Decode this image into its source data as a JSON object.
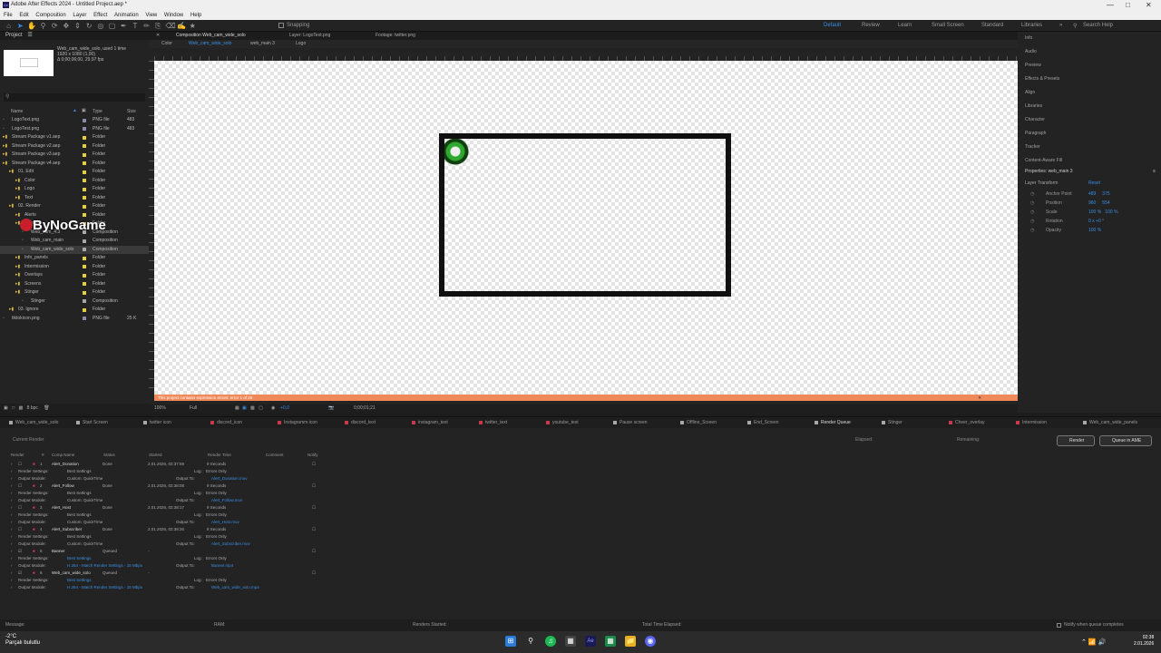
{
  "window": {
    "title": "Adobe After Effects 2024 - Untitled Project.aep *"
  },
  "menu": [
    "File",
    "Edit",
    "Composition",
    "Layer",
    "Effect",
    "Animation",
    "View",
    "Window",
    "Help"
  ],
  "toolbar": {
    "snapping": "Snapping",
    "workspaces": [
      "Default",
      "Review",
      "Learn",
      "Small Screen",
      "Standard",
      "Libraries"
    ],
    "search_help": "Search Help"
  },
  "project": {
    "tab": "Project",
    "selected_name": "Web_cam_wide_solo",
    "selected_used": ", used 1 time",
    "selected_info1": "1920 x 1080 (1,00)",
    "selected_info2": "Δ 0;00;06;00, 29,97 fps",
    "columns": {
      "name": "Name",
      "type": "Type",
      "size": "Size"
    },
    "items": [
      {
        "name": "LogoText.png",
        "type": "PNG file",
        "size": "483",
        "indent": 0,
        "color": "#8a8aa8"
      },
      {
        "name": "LogoTest.png",
        "type": "PNG file",
        "size": "483",
        "indent": 0,
        "color": "#8a8aa8"
      },
      {
        "name": "Stream Package v1.aep",
        "type": "Folder",
        "size": "",
        "indent": 0,
        "color": "#e6cf3a"
      },
      {
        "name": "Stream Package v2.aep",
        "type": "Folder",
        "size": "",
        "indent": 0,
        "color": "#e6cf3a"
      },
      {
        "name": "Stream Package v3.aep",
        "type": "Folder",
        "size": "",
        "indent": 0,
        "color": "#e6cf3a"
      },
      {
        "name": "Stream Package v4.aep",
        "type": "Folder",
        "size": "",
        "indent": 0,
        "color": "#e6cf3a"
      },
      {
        "name": "01. Edit",
        "type": "Folder",
        "size": "",
        "indent": 1,
        "color": "#e6cf3a"
      },
      {
        "name": "Color",
        "type": "Folder",
        "size": "",
        "indent": 2,
        "color": "#e6cf3a"
      },
      {
        "name": "Logo",
        "type": "Folder",
        "size": "",
        "indent": 2,
        "color": "#e6cf3a"
      },
      {
        "name": "Text",
        "type": "Folder",
        "size": "",
        "indent": 2,
        "color": "#e6cf3a"
      },
      {
        "name": "02. Render",
        "type": "Folder",
        "size": "",
        "indent": 1,
        "color": "#e6cf3a"
      },
      {
        "name": "Alerts",
        "type": "Folder",
        "size": "",
        "indent": 2,
        "color": "#e6cf3a"
      },
      {
        "name": "Banner",
        "type": "Folder",
        "size": "",
        "indent": 2,
        "color": "#e6cf3a"
      },
      {
        "name": "Web_cam_4:3",
        "type": "Composition",
        "size": "",
        "indent": 3,
        "color": "#a8a8a8"
      },
      {
        "name": "Web_cam_main",
        "type": "Composition",
        "size": "",
        "indent": 3,
        "color": "#a8a8a8"
      },
      {
        "name": "Web_cam_wide_solo",
        "type": "Composition",
        "size": "",
        "indent": 3,
        "color": "#a8a8a8",
        "selected": true
      },
      {
        "name": "Info_panels",
        "type": "Folder",
        "size": "",
        "indent": 2,
        "color": "#e6cf3a"
      },
      {
        "name": "Intermission",
        "type": "Folder",
        "size": "",
        "indent": 2,
        "color": "#e6cf3a"
      },
      {
        "name": "Overlays",
        "type": "Folder",
        "size": "",
        "indent": 2,
        "color": "#e6cf3a"
      },
      {
        "name": "Screens",
        "type": "Folder",
        "size": "",
        "indent": 2,
        "color": "#e6cf3a"
      },
      {
        "name": "Stinger",
        "type": "Folder",
        "size": "",
        "indent": 2,
        "color": "#e6cf3a"
      },
      {
        "name": "Stinger",
        "type": "Composition",
        "size": "",
        "indent": 3,
        "color": "#a8a8a8"
      },
      {
        "name": "03. Ignore",
        "type": "Folder",
        "size": "",
        "indent": 1,
        "color": "#e6cf3a"
      },
      {
        "name": "tiktokicon.png",
        "type": "PNG file",
        "size": "25 K",
        "indent": 0,
        "color": "#8a8aa8"
      }
    ],
    "watermark": "ByNoGame",
    "bpc": "8 bpc"
  },
  "comp": {
    "tabs": [
      "Composition Web_cam_wide_solo",
      "Layer: LogoText.png",
      "Footage: twitter.png"
    ],
    "subtabs": [
      "Color",
      "Web_cam_wide_solo",
      "web_main 3",
      "Logo"
    ],
    "warning": "This project contains expression errors: error 1 of 26",
    "zoom": "100%",
    "resolution": "Full",
    "timecode": "0;00;01;21",
    "exposure": "+0,0"
  },
  "right": {
    "panels": [
      "Info",
      "Audio",
      "Preview",
      "Effects & Presets",
      "Align",
      "Libraries",
      "Character",
      "Paragraph",
      "Tracker",
      "Content-Aware Fill"
    ],
    "properties_title": "Properties: web_main 3",
    "layer_transform": "Layer Transform",
    "reset": "Reset",
    "props": [
      {
        "label": "Anchor Point",
        "value": "489     375"
      },
      {
        "label": "Position",
        "value": "960     554"
      },
      {
        "label": "Scale",
        "value": "100 %   100 %"
      },
      {
        "label": "Rotation",
        "value": "0 x +0 °"
      },
      {
        "label": "Opacity",
        "value": "100 %"
      }
    ]
  },
  "timeline_tabs": [
    "Web_cam_wide_solo",
    "Start Screen",
    "twitter icon",
    "discord_icon",
    "Instagramm icon",
    "discord_text",
    "instagram_text",
    "twitter_text",
    "youtube_text",
    "Pause screen",
    "Offline_Screen",
    "End_Screen",
    "Render Queue",
    "Stinger",
    "Cheer_overlay",
    "Intermission",
    "Web_cam_wide_panels"
  ],
  "timeline_tab_colors": [
    "#a8a8a8",
    "#a8a8a8",
    "#a8a8a8",
    "#c83a4a",
    "#c83a4a",
    "#c83a4a",
    "#c83a4a",
    "#c83a4a",
    "#c83a4a",
    "#a8a8a8",
    "#a8a8a8",
    "#a8a8a8",
    "#a8a8a8",
    "#a8a8a8",
    "#c83a4a",
    "#c83a4a",
    "#a8a8a8"
  ],
  "render_queue": {
    "current_render": "Current Render",
    "elapsed_label": "Elapsed:",
    "remaining_label": "Remaining:",
    "render_button": "Render",
    "queue_ame": "Queue in AME",
    "columns": [
      "Render",
      "#",
      "Comp Name",
      "Status",
      "Started",
      "Render Time",
      "Comment",
      "Notify"
    ],
    "items": [
      {
        "num": "1",
        "name": "Alert_Donation",
        "status": "Done",
        "started": "2.01.2026, 02:37:59",
        "time": "9 Seconds",
        "rs": "Best Settings",
        "log": "Errors Only",
        "om": "Custom: QuickTime",
        "out": "Alert_Donation.mov",
        "checked": false,
        "blue": false
      },
      {
        "num": "2",
        "name": "Alert_Follow",
        "status": "Done",
        "started": "2.01.2026, 02:38:08",
        "time": "9 Seconds",
        "rs": "Best Settings",
        "log": "Errors Only",
        "om": "Custom: QuickTime",
        "out": "Alert_Follow.mov",
        "checked": false,
        "blue": false
      },
      {
        "num": "3",
        "name": "Alert_Host",
        "status": "Done",
        "started": "2.01.2026, 02:38:17",
        "time": "9 Seconds",
        "rs": "Best Settings",
        "log": "Errors Only",
        "om": "Custom: QuickTime",
        "out": "Alert_Host.mov",
        "checked": false,
        "blue": false
      },
      {
        "num": "4",
        "name": "Alert_Subscriber",
        "status": "Done",
        "started": "2.01.2026, 02:38:26",
        "time": "8 Seconds",
        "rs": "Best Settings",
        "log": "Errors Only",
        "om": "Custom: QuickTime",
        "out": "Alert_Subscriber.mov",
        "checked": false,
        "blue": false
      },
      {
        "num": "5",
        "name": "Banner",
        "status": "Queued",
        "started": "-",
        "time": "",
        "rs": "Best Settings",
        "log": "Errors Only",
        "om": "H.264 - Match Render Settings - 15 Mbps",
        "out": "Banner.mp4",
        "checked": true,
        "blue": true
      },
      {
        "num": "6",
        "name": "Web_cam_wide_solo",
        "status": "Queued",
        "started": "-",
        "time": "",
        "rs": "Best Settings",
        "log": "Errors Only",
        "om": "H.264 - Match Render Settings - 15 Mbps",
        "out": "Web_cam_wide_solo.mp4",
        "checked": true,
        "blue": true
      }
    ],
    "rs_label": "Render Settings:",
    "om_label": "Output Module:",
    "log_label": "Log:",
    "out_label": "Output To:"
  },
  "status": {
    "message": "Message:",
    "ram": "RAM:",
    "renders_started": "Renders Started:",
    "total_elapsed": "Total Time Elapsed:",
    "notify": "Notify when queue completes"
  },
  "taskbar": {
    "weather_temp": "-2°C",
    "weather_desc": "Parçalı bulutlu",
    "time": "02:38",
    "date": "2.01.2026"
  }
}
